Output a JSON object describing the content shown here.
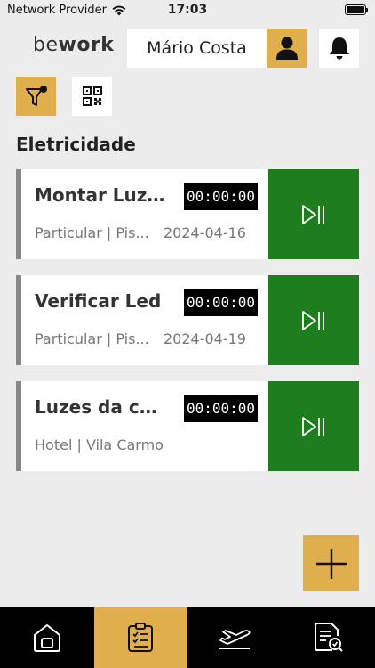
{
  "status_bar": {
    "carrier": "Network Provider",
    "time": "17:03"
  },
  "header": {
    "logo_prefix": "be",
    "logo_suffix": "work",
    "user_name": "Mário Costa"
  },
  "section": {
    "title": "Eletricidade"
  },
  "tasks": [
    {
      "title": "Montar Luzes",
      "timer": "00:00:00",
      "subtitle": "Particular | Pis...",
      "date": "2024-04-16"
    },
    {
      "title": "Verificar Led",
      "timer": "00:00:00",
      "subtitle": "Particular | Pis...",
      "date": "2024-04-19"
    },
    {
      "title": "Luzes da coz...",
      "timer": "00:00:00",
      "subtitle": "Hotel | Vila Carmo",
      "date": ""
    }
  ],
  "nav": {
    "active": "tasks",
    "items": [
      "home-icon",
      "tasks-icon",
      "flight-icon",
      "report-icon"
    ]
  },
  "colors": {
    "accent": "#e1ae4d",
    "play": "#1e7e1e",
    "nav_bg": "#000000",
    "background": "#ececec"
  }
}
